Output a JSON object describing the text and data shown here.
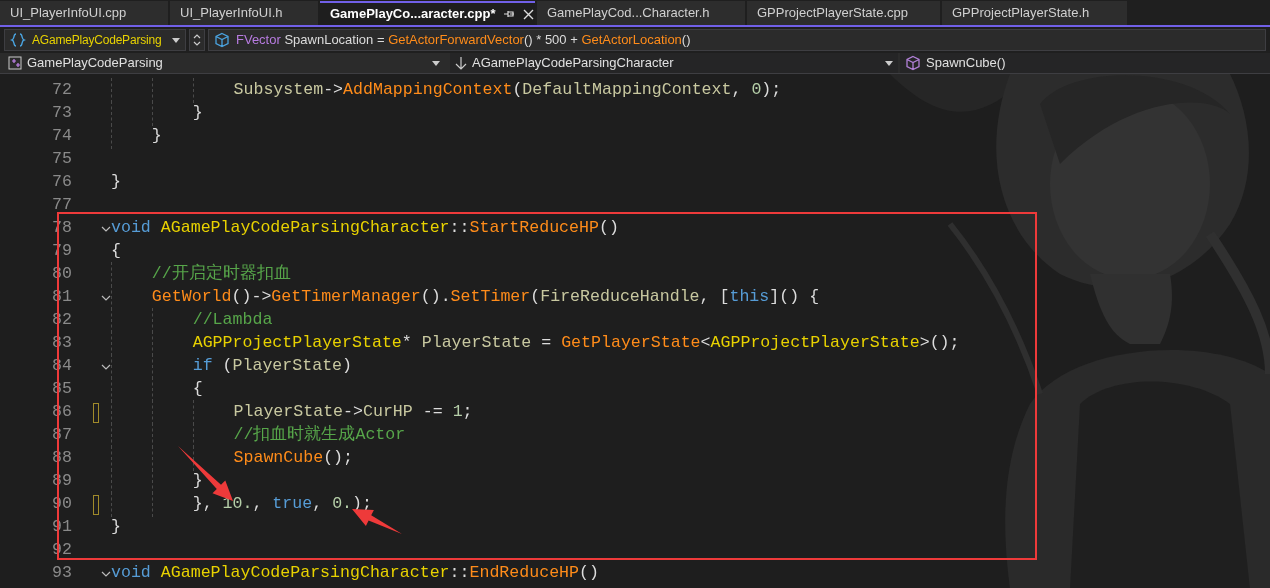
{
  "tabs": [
    {
      "label": "UI_PlayerInfoUI.cpp",
      "selected": false
    },
    {
      "label": "UI_PlayerInfoUI.h",
      "selected": false
    },
    {
      "label": "GamePlayCo...aracter.cpp*",
      "selected": true
    },
    {
      "label": "GamePlayCod...Character.h",
      "selected": false
    },
    {
      "label": "GPProjectPlayerState.cpp",
      "selected": false
    },
    {
      "label": "GPProjectPlayerState.h",
      "selected": false
    }
  ],
  "toolbar": {
    "scope": "AGamePlayCodeParsing",
    "definition": [
      {
        "text": "FVector",
        "kind": "typename"
      },
      {
        "text": " SpawnLocation = ",
        "kind": "plain"
      },
      {
        "text": "GetActorForwardVector",
        "kind": "function"
      },
      {
        "text": "() * 500 + ",
        "kind": "plain"
      },
      {
        "text": "GetActorLocation",
        "kind": "function"
      },
      {
        "text": "()",
        "kind": "plain"
      }
    ]
  },
  "navigation": {
    "project": "GamePlayCodeParsing",
    "class": "AGamePlayCodeParsingCharacter",
    "member": "SpawnCube()"
  },
  "lines": [
    {
      "number": "72",
      "foldable": false,
      "changed": false,
      "tokens": [
        {
          "text": "            Subsystem",
          "kind": "variable"
        },
        {
          "text": "->",
          "kind": "plain"
        },
        {
          "text": "AddMappingContext",
          "kind": "function"
        },
        {
          "text": "(",
          "kind": "plain"
        },
        {
          "text": "DefaultMappingContext",
          "kind": "variable"
        },
        {
          "text": ", ",
          "kind": "plain"
        },
        {
          "text": "0",
          "kind": "number"
        },
        {
          "text": ");",
          "kind": "plain"
        }
      ]
    },
    {
      "number": "73",
      "foldable": false,
      "changed": false,
      "tokens": [
        {
          "text": "        }",
          "kind": "plain"
        }
      ]
    },
    {
      "number": "74",
      "foldable": false,
      "changed": false,
      "tokens": [
        {
          "text": "    }",
          "kind": "plain"
        }
      ]
    },
    {
      "number": "75",
      "foldable": false,
      "changed": false
    },
    {
      "number": "76",
      "foldable": false,
      "changed": false,
      "tokens": [
        {
          "text": "}",
          "kind": "plain"
        }
      ]
    },
    {
      "number": "77",
      "foldable": false,
      "changed": false
    },
    {
      "number": "78",
      "foldable": true,
      "changed": false,
      "tokens": [
        {
          "text": "void ",
          "kind": "keyword"
        },
        {
          "text": "AGamePlayCodeParsingCharacter",
          "kind": "type"
        },
        {
          "text": "::",
          "kind": "plain"
        },
        {
          "text": "StartReduceHP",
          "kind": "function"
        },
        {
          "text": "()",
          "kind": "plain"
        }
      ]
    },
    {
      "number": "79",
      "foldable": false,
      "changed": false,
      "tokens": [
        {
          "text": "{",
          "kind": "plain"
        }
      ]
    },
    {
      "number": "80",
      "foldable": false,
      "changed": false,
      "tokens": [
        {
          "text": "    //开启定时器扣血",
          "kind": "comment"
        }
      ]
    },
    {
      "number": "81",
      "foldable": true,
      "changed": false,
      "tokens": [
        {
          "text": "    GetWorld",
          "kind": "function"
        },
        {
          "text": "()->",
          "kind": "plain"
        },
        {
          "text": "GetTimerManager",
          "kind": "function"
        },
        {
          "text": "().",
          "kind": "plain"
        },
        {
          "text": "SetTimer",
          "kind": "function"
        },
        {
          "text": "(",
          "kind": "plain"
        },
        {
          "text": "FireReduceHandle",
          "kind": "variable"
        },
        {
          "text": ", [",
          "kind": "plain"
        },
        {
          "text": "this",
          "kind": "keyword"
        },
        {
          "text": "]() {",
          "kind": "plain"
        }
      ]
    },
    {
      "number": "82",
      "foldable": false,
      "changed": false,
      "tokens": [
        {
          "text": "        //Lambda",
          "kind": "comment"
        }
      ]
    },
    {
      "number": "83",
      "foldable": false,
      "changed": false,
      "tokens": [
        {
          "text": "        AGPProjectPlayerState",
          "kind": "type"
        },
        {
          "text": "* ",
          "kind": "plain"
        },
        {
          "text": "PlayerState",
          "kind": "variable"
        },
        {
          "text": " = ",
          "kind": "plain"
        },
        {
          "text": "GetPlayerState",
          "kind": "function"
        },
        {
          "text": "<",
          "kind": "plain"
        },
        {
          "text": "AGPProjectPlayerState",
          "kind": "type"
        },
        {
          "text": ">();",
          "kind": "plain"
        }
      ]
    },
    {
      "number": "84",
      "foldable": true,
      "changed": false,
      "tokens": [
        {
          "text": "        if",
          "kind": "keyword"
        },
        {
          "text": " (",
          "kind": "plain"
        },
        {
          "text": "PlayerState",
          "kind": "variable"
        },
        {
          "text": ")",
          "kind": "plain"
        }
      ]
    },
    {
      "number": "85",
      "foldable": false,
      "changed": false,
      "tokens": [
        {
          "text": "        {",
          "kind": "plain"
        }
      ]
    },
    {
      "number": "86",
      "foldable": false,
      "changed": true,
      "tokens": [
        {
          "text": "            PlayerState",
          "kind": "variable"
        },
        {
          "text": "->",
          "kind": "plain"
        },
        {
          "text": "CurHP",
          "kind": "variable"
        },
        {
          "text": " -= ",
          "kind": "plain"
        },
        {
          "text": "1",
          "kind": "number"
        },
        {
          "text": ";",
          "kind": "plain"
        }
      ]
    },
    {
      "number": "87",
      "foldable": false,
      "changed": false,
      "tokens": [
        {
          "text": "            //扣血时就生成Actor",
          "kind": "comment"
        }
      ]
    },
    {
      "number": "88",
      "foldable": false,
      "changed": false,
      "tokens": [
        {
          "text": "            SpawnCube",
          "kind": "function"
        },
        {
          "text": "();",
          "kind": "plain"
        }
      ]
    },
    {
      "number": "89",
      "foldable": false,
      "changed": false,
      "tokens": [
        {
          "text": "        }",
          "kind": "plain"
        }
      ]
    },
    {
      "number": "90",
      "foldable": false,
      "changed": true,
      "tokens": [
        {
          "text": "        }, ",
          "kind": "plain"
        },
        {
          "text": "10.",
          "kind": "number"
        },
        {
          "text": ", ",
          "kind": "plain"
        },
        {
          "text": "true",
          "kind": "keyword"
        },
        {
          "text": ", ",
          "kind": "plain"
        },
        {
          "text": "0.",
          "kind": "number"
        },
        {
          "text": ");",
          "kind": "plain"
        }
      ]
    },
    {
      "number": "91",
      "foldable": false,
      "changed": false,
      "tokens": [
        {
          "text": "}",
          "kind": "plain"
        }
      ]
    },
    {
      "number": "92",
      "foldable": false,
      "changed": false
    },
    {
      "number": "93",
      "foldable": true,
      "changed": false,
      "tokens": [
        {
          "text": "void ",
          "kind": "keyword"
        },
        {
          "text": "AGamePlayCodeParsingCharacter",
          "kind": "type"
        },
        {
          "text": "::",
          "kind": "plain"
        },
        {
          "text": "EndReduceHP",
          "kind": "function"
        },
        {
          "text": "()",
          "kind": "plain"
        }
      ]
    }
  ]
}
